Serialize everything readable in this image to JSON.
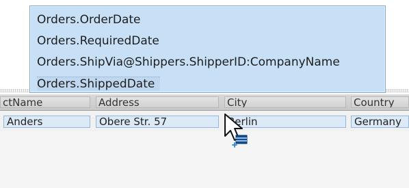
{
  "field_list": {
    "items": [
      "Orders.OrderDate",
      "Orders.RequiredDate",
      "Orders.ShipVia@Shippers.ShipperID:CompanyName",
      "Orders.ShippedDate"
    ]
  },
  "grid": {
    "headers": [
      "ctName",
      "Address",
      "City",
      "Country"
    ],
    "rows": [
      [
        "Anders",
        "Obere Str. 57",
        "Berlin",
        "Germany"
      ]
    ]
  },
  "colors": {
    "popup_fill": "#c8e0f6",
    "popup_border": "#7fa8d2",
    "cell_fill": "#dce9f6",
    "cell_border": "#93b7dd"
  },
  "icons": {
    "cursor": "drag-arrow-icon",
    "add": "add-field-icon"
  }
}
